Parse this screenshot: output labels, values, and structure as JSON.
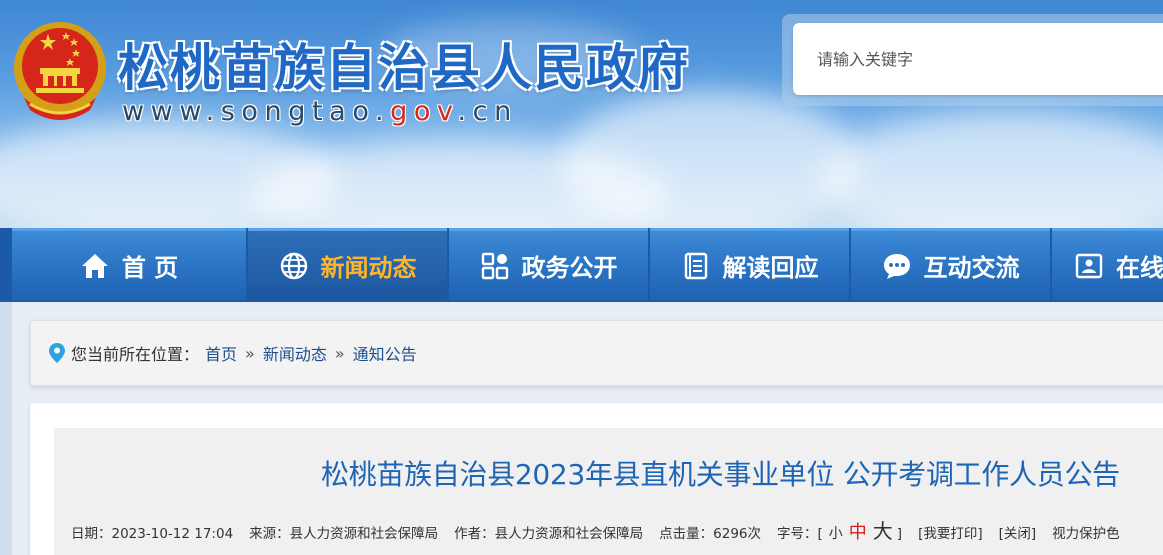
{
  "header": {
    "site_title": "松桃苗族自治县人民政府",
    "url_prefix": "www.songtao.",
    "url_gov": "gov",
    "url_suffix": ".cn",
    "search_placeholder": "请输入关键字"
  },
  "nav": {
    "items": [
      {
        "label": "首 页",
        "icon": "home-icon"
      },
      {
        "label": "新闻动态",
        "icon": "globe-icon",
        "active": true
      },
      {
        "label": "政务公开",
        "icon": "grid-icon"
      },
      {
        "label": "解读回应",
        "icon": "book-icon"
      },
      {
        "label": "互动交流",
        "icon": "chat-icon"
      },
      {
        "label": "在线",
        "icon": "id-card-icon"
      }
    ]
  },
  "breadcrumb": {
    "prefix": "您当前所在位置：",
    "items": [
      "首页",
      "新闻动态",
      "通知公告"
    ],
    "separator": "»"
  },
  "article": {
    "title": "松桃苗族自治县2023年县直机关事业单位 公开考调工作人员公告",
    "date_label": "日期：",
    "date": "2023-10-12 17:04",
    "source_label": "来源：",
    "source": "县人力资源和社会保障局",
    "author_label": "作者：",
    "author": "县人力资源和社会保障局",
    "views_label": "点击量：",
    "views": "6296次",
    "font_size_label": "字号：[",
    "font_small": "小",
    "font_mid": "中",
    "font_big": "大",
    "font_size_end": "]",
    "print": "[我要打印]",
    "close": "[关闭]",
    "eye_protect": "视力保护色"
  },
  "colors": {
    "title_blue": "#1f65b5",
    "nav_blue": "#2a72c2",
    "nav_active_text": "#ffb52a",
    "accent_red": "#d0221b"
  }
}
